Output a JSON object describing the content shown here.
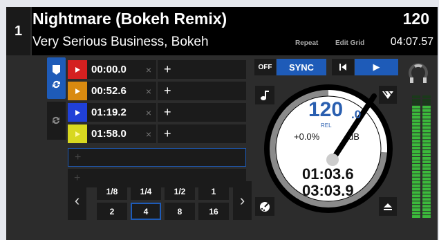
{
  "deck": {
    "number": "1",
    "title": "Nightmare (Bokeh Remix)",
    "artist": "Very Serious Business, Bokeh",
    "bpm": "120",
    "repeat_label": "Repeat",
    "edit_grid_label": "Edit Grid",
    "time_total": "04:07.57"
  },
  "cues": [
    {
      "time": "00:00.0",
      "color": "#d42020",
      "delete": "×",
      "add": "+"
    },
    {
      "time": "00:52.6",
      "color": "#d98a10",
      "delete": "×",
      "add": "+"
    },
    {
      "time": "01:19.2",
      "color": "#2040d8",
      "delete": "×",
      "add": "+"
    },
    {
      "time": "01:58.0",
      "color": "#d8d820",
      "delete": "×",
      "add": "+"
    }
  ],
  "empty_rows": [
    {
      "add": "+"
    },
    {
      "add": "+"
    }
  ],
  "loop_sizes": {
    "top": [
      "1/8",
      "1/4",
      "1/2",
      "1"
    ],
    "bottom": [
      "2",
      "4",
      "8",
      "16"
    ],
    "selected": "4"
  },
  "transport": {
    "off_label": "OFF",
    "sync_label": "SYNC",
    "play_glyph": "▶"
  },
  "jog": {
    "bpm_int": "120",
    "bpm_dec": ".0",
    "rel_label": "REL",
    "pitch": "+0.0%",
    "gain": "dB",
    "elapsed": "01:03.6",
    "remaining": "03:03.9",
    "progress": 0.26
  },
  "colors": {
    "accent": "#1e5bb8",
    "panel": "#2c2c2c",
    "button": "#1b1b1b",
    "meter_green": "#3cba3c",
    "meter_orange": "#d07020"
  },
  "meter_level": 0.93
}
